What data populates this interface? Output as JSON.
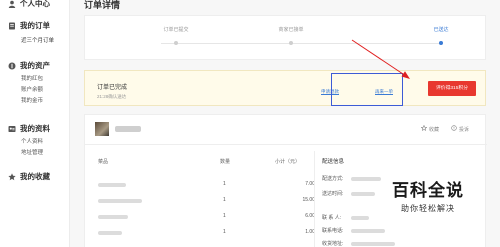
{
  "sidebar": {
    "personal_center": "个人中心",
    "my_orders": {
      "title": "我的订单",
      "items": [
        "近三个月订单"
      ]
    },
    "my_assets": {
      "title": "我的资产",
      "items": [
        "我的红包",
        "账户余额",
        "我的金币"
      ]
    },
    "my_profile": {
      "title": "我的资料",
      "items": [
        "个人资料",
        "地址管理"
      ]
    },
    "my_favorites": {
      "title": "我的收藏"
    }
  },
  "main": {
    "title": "订单详情",
    "steps": [
      {
        "label": "订单已提交",
        "active": false
      },
      {
        "label": "商家已接单",
        "active": false
      },
      {
        "label": "已送达",
        "active": true
      }
    ],
    "status": {
      "title": "订单已完成",
      "subtitle": "21:28确认送达",
      "link_1": "申请退款",
      "link_2": "再来一单",
      "pay_button": "评价得315积分"
    },
    "shop": {
      "favorite": "收藏",
      "complaint": "投诉"
    },
    "table": {
      "headers": [
        "菜品",
        "数量",
        "小计（元）"
      ],
      "rows": [
        {
          "qty": "1",
          "subtotal": "7.00"
        },
        {
          "qty": "1",
          "subtotal": "15.00"
        },
        {
          "qty": "1",
          "subtotal": "6.00"
        },
        {
          "qty": "1",
          "subtotal": "1.00"
        }
      ]
    },
    "shipping": {
      "title": "配送信息",
      "labels": [
        "配送方式:",
        "送达时间:",
        "联 系 人:",
        "联系电话:",
        "收货地址:"
      ]
    }
  },
  "watermark": {
    "title": "百科全说",
    "subtitle": "助你轻松解决"
  },
  "colors": {
    "accent_blue": "#3a7bd5",
    "pay_red": "#e8382f",
    "highlight_blue": "#3d5bd6",
    "status_bg": "#fffbea"
  }
}
